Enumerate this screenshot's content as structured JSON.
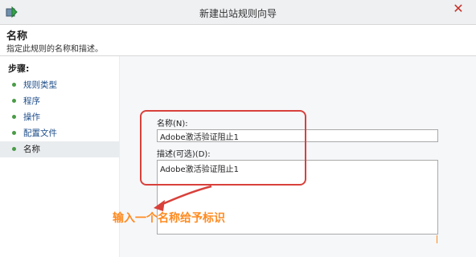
{
  "window": {
    "title": "新建出站规则向导",
    "close_glyph": "✕"
  },
  "header": {
    "title": "名称",
    "description": "指定此规则的名称和描述。"
  },
  "sidebar": {
    "heading": "步骤:",
    "steps": [
      {
        "label": "规则类型"
      },
      {
        "label": "程序"
      },
      {
        "label": "操作"
      },
      {
        "label": "配置文件"
      },
      {
        "label": "名称"
      }
    ]
  },
  "form": {
    "name_label": "名称(N):",
    "name_value": "Adobe激活验证阻止1",
    "description_label": "描述(可选)(D):",
    "description_value": "Adobe激活验证阻止1"
  },
  "annotation": {
    "text": "输入一个名称给予标识",
    "color": "#ff8a1f"
  },
  "colors": {
    "highlight": "#d8413b",
    "step_dot": "#4a9b47",
    "link": "#1f4e8a"
  },
  "icons": [
    "app-window-icon",
    "close-icon",
    "step-bullet-icon",
    "arrow-icon"
  ]
}
